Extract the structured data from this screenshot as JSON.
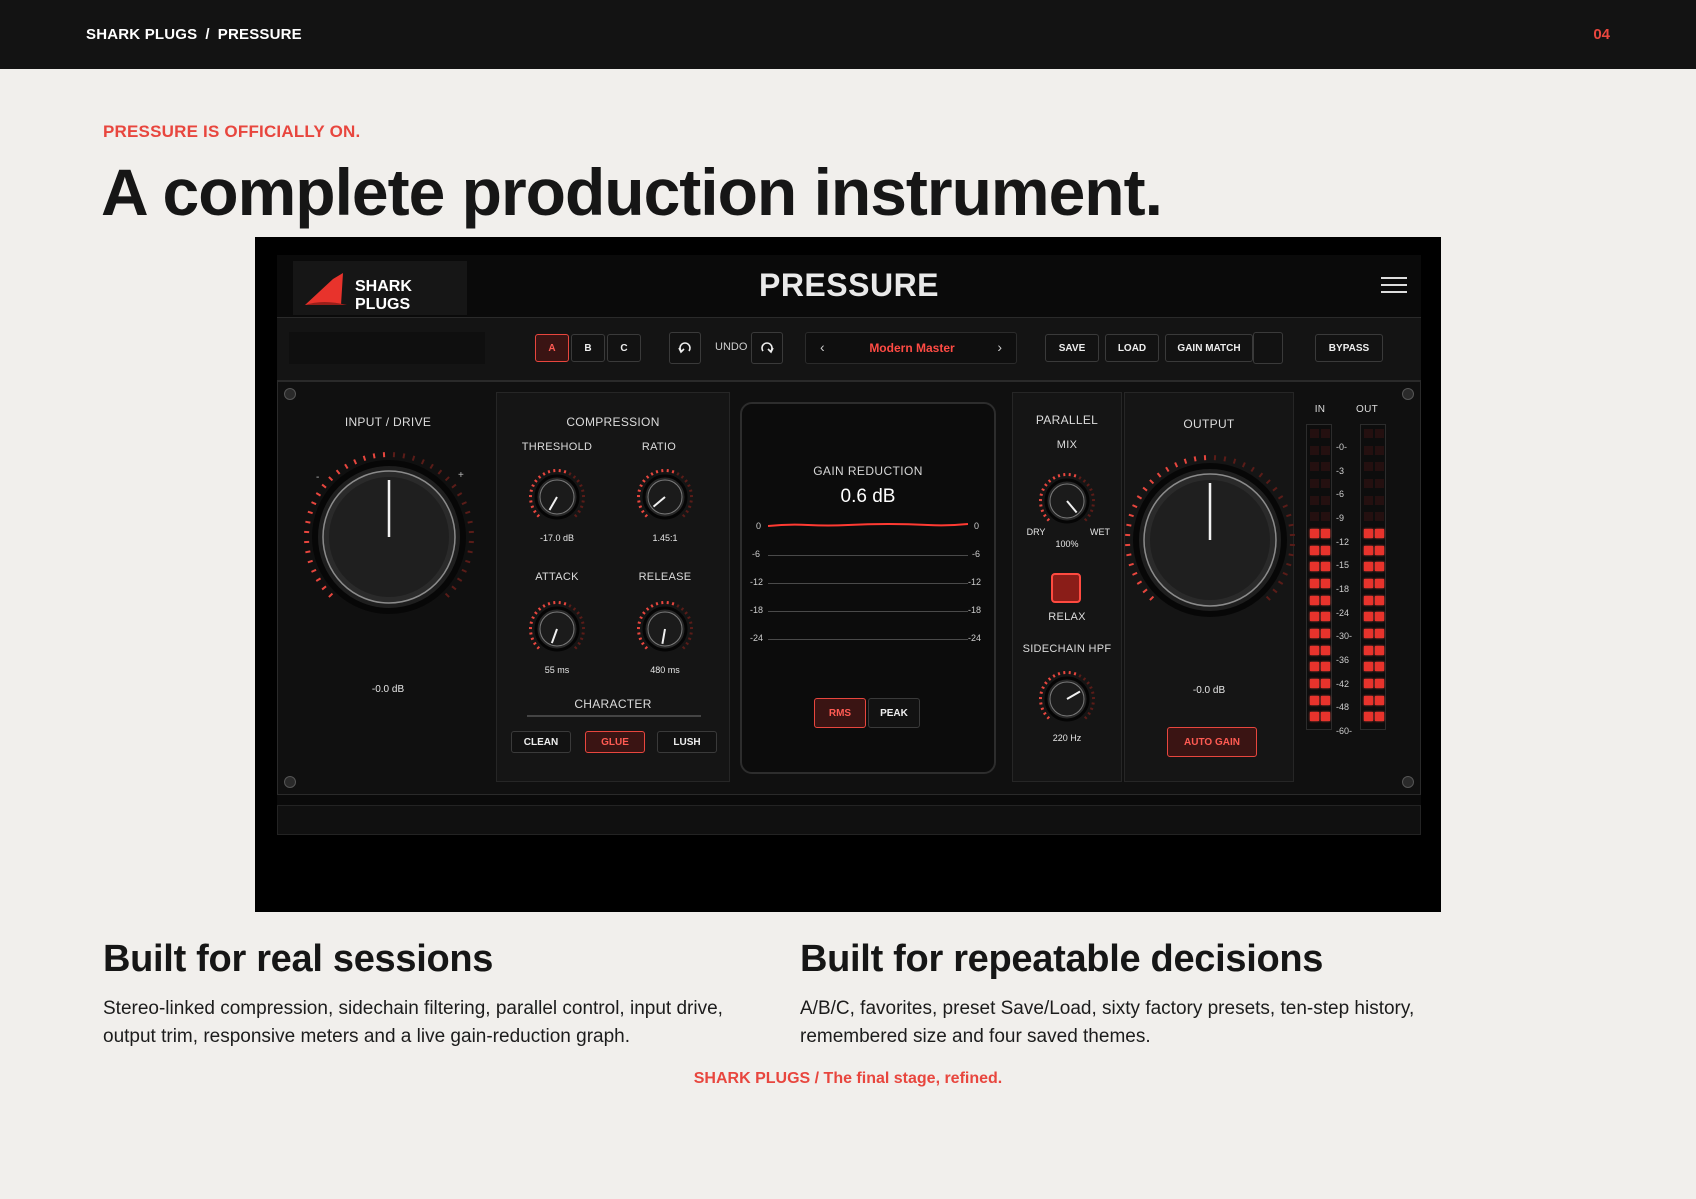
{
  "header": {
    "crumbs": [
      "SHARK PLUGS",
      "PRESSURE"
    ],
    "separator": "/",
    "page_number": "04"
  },
  "kicker": "PRESSURE IS OFFICIALLY ON.",
  "headline": "A complete production instrument.",
  "plugin": {
    "brand": "SHARK PLUGS",
    "title": "PRESSURE",
    "toolbar": {
      "ab_slots": [
        "A",
        "B",
        "C"
      ],
      "active_slot": "A",
      "undo_label": "UNDO",
      "preset_name": "Modern Master",
      "prev_symbol": "‹",
      "next_symbol": "›",
      "save_label": "SAVE",
      "load_label": "LOAD",
      "gain_match_label": "GAIN MATCH",
      "bypass_label": "BYPASS"
    },
    "input": {
      "label": "INPUT / DRIVE",
      "value": "-0.0 dB",
      "min_mark": "-",
      "max_mark": "+"
    },
    "compression": {
      "label": "COMPRESSION",
      "threshold_label": "THRESHOLD",
      "threshold_value": "-17.0 dB",
      "ratio_label": "RATIO",
      "ratio_value": "1.45:1",
      "attack_label": "ATTACK",
      "attack_value": "55 ms",
      "release_label": "RELEASE",
      "release_value": "480 ms",
      "character_label": "CHARACTER",
      "character_options": [
        "CLEAN",
        "GLUE",
        "LUSH"
      ],
      "character_selected": "GLUE"
    },
    "gain_reduction": {
      "label": "GAIN REDUCTION",
      "value": "0.6 dB",
      "scale": [
        "0",
        "-6",
        "-12",
        "-18",
        "-24"
      ],
      "modes": [
        "RMS",
        "PEAK"
      ],
      "selected_mode": "RMS"
    },
    "parallel": {
      "label": "PARALLEL",
      "mix_label": "MIX",
      "dry_label": "DRY",
      "wet_label": "WET",
      "mix_value": "100%",
      "relax_label": "RELAX",
      "sidechain_label": "SIDECHAIN HPF",
      "sidechain_value": "220 Hz"
    },
    "output": {
      "label": "OUTPUT",
      "value": "-0.0 dB",
      "auto_gain_label": "AUTO GAIN"
    },
    "meters": {
      "in_label": "IN",
      "out_label": "OUT",
      "scale": [
        "-0-",
        "-3",
        "-6",
        "-9",
        "-12",
        "-15",
        "-18",
        "-24",
        "-30-",
        "-36",
        "-42",
        "-48",
        "-60-"
      ],
      "in_level": 0.72,
      "out_level": 0.72
    },
    "colors": {
      "accent": "#e8463e",
      "panel": "#151515",
      "background": "#0a0a0a"
    }
  },
  "sections": [
    {
      "title": "Built for real sessions",
      "body": "Stereo-linked compression, sidechain filtering, parallel control, input drive, output trim, responsive meters and a live gain-reduction graph."
    },
    {
      "title": "Built for repeatable decisions",
      "body": "A/B/C, favorites, preset Save/Load, sixty factory presets, ten-step history, remembered size and four saved themes."
    }
  ],
  "footer": "SHARK PLUGS / The final stage, refined."
}
